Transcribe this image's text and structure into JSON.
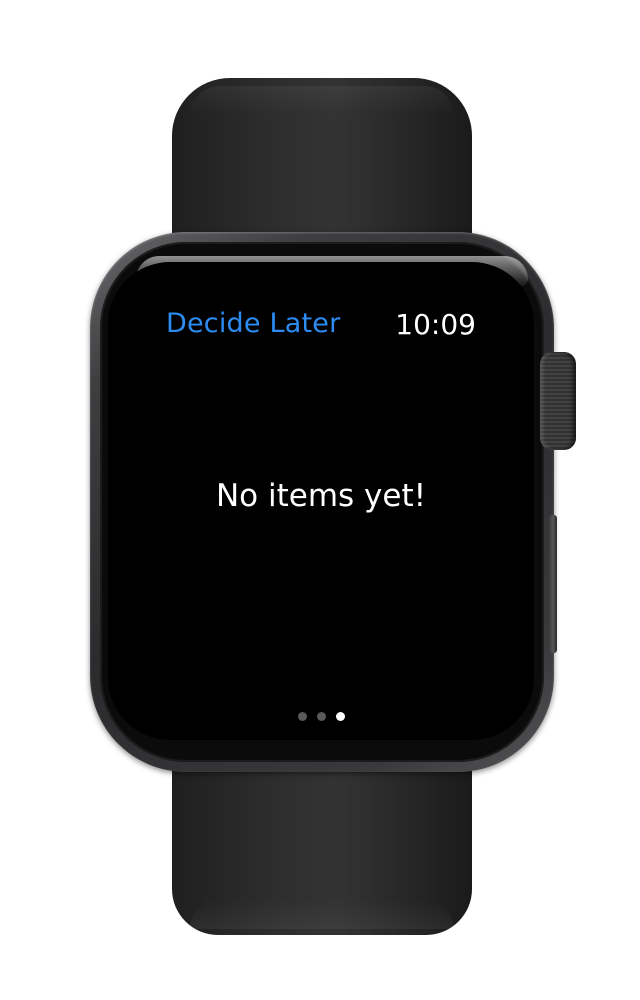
{
  "watch": {
    "app_title": "Decide Later",
    "time": "10:09"
  },
  "main": {
    "empty_message": "No items yet!"
  },
  "pagination": {
    "page_count": 3,
    "current_page": 3
  },
  "colors": {
    "accent": "#2c8cf2",
    "screen_background": "#000000",
    "text": "#ffffff",
    "band": "#2e2e2e",
    "case": "#3a3a3c"
  }
}
